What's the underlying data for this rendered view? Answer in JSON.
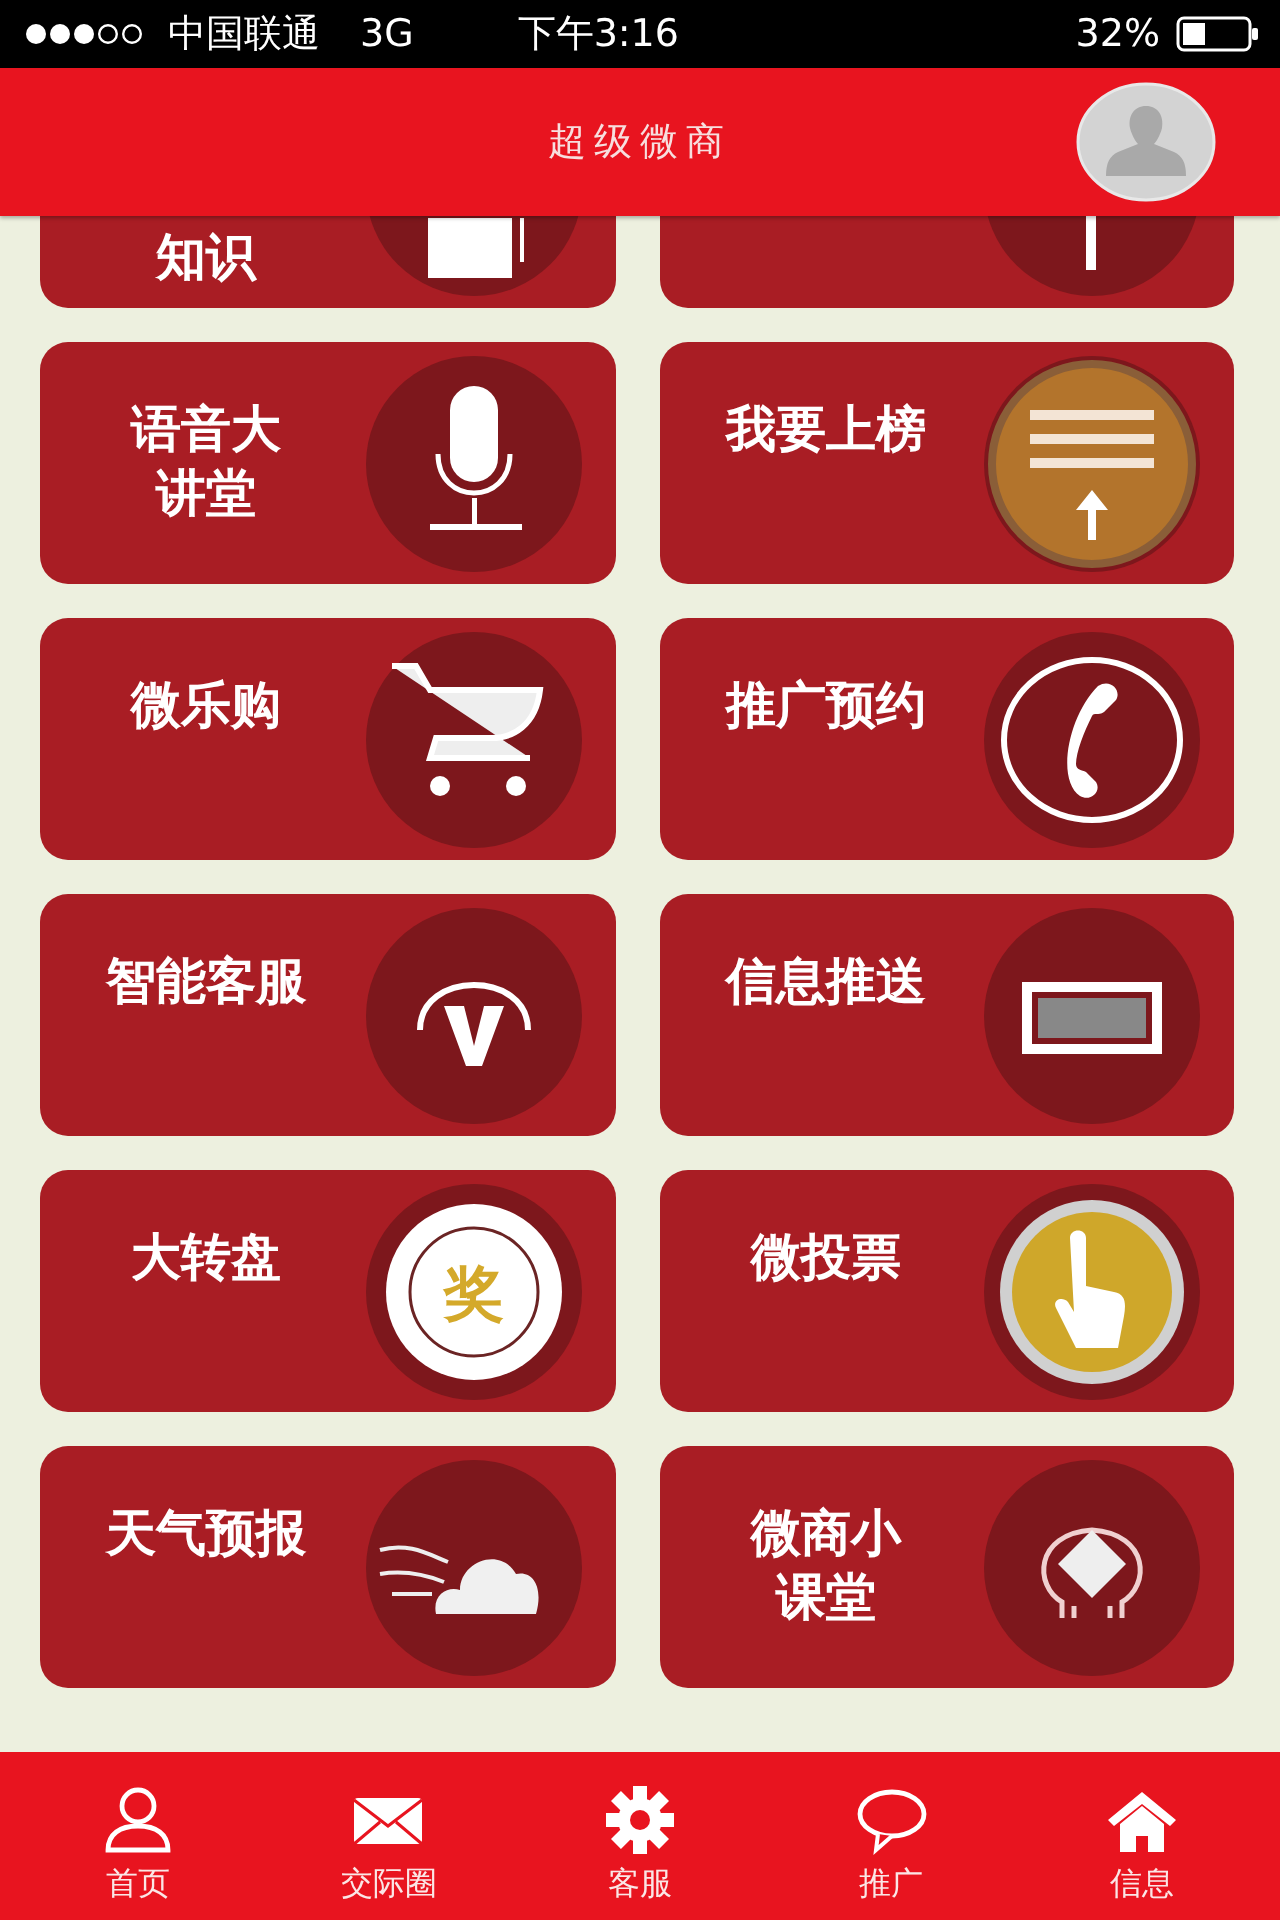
{
  "status_bar": {
    "carrier": "中国联通",
    "network": "3G",
    "time": "下午3:16",
    "battery": "32%"
  },
  "header": {
    "title": "超级微商"
  },
  "top_row": {
    "label": "知识"
  },
  "tiles": [
    {
      "lines": [
        "语音大",
        "讲堂"
      ]
    },
    {
      "lines": [
        "我要上榜"
      ]
    },
    {
      "lines": [
        "微乐购"
      ]
    },
    {
      "lines": [
        "推广预约"
      ]
    },
    {
      "lines": [
        "智能客服"
      ]
    },
    {
      "lines": [
        "信息推送"
      ]
    },
    {
      "lines": [
        "大转盘"
      ],
      "icon_text": "奖"
    },
    {
      "lines": [
        "微投票"
      ]
    },
    {
      "lines": [
        "天气预报"
      ]
    },
    {
      "lines": [
        "微商小",
        "课堂"
      ]
    }
  ],
  "nav": [
    {
      "label": "首页"
    },
    {
      "label": "交际圈"
    },
    {
      "label": "客服"
    },
    {
      "label": "推广"
    },
    {
      "label": "信息"
    }
  ]
}
